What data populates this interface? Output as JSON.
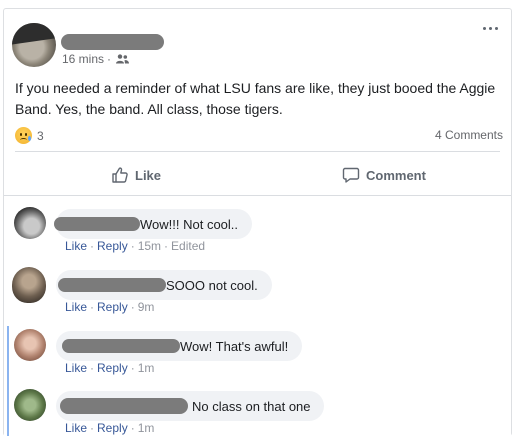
{
  "post": {
    "time": "16 mins",
    "separator": "·",
    "audience_icon": "group-icon",
    "text": "If you needed a reminder of what LSU fans are like, they just booed the Aggie Band. Yes, the band. All class, those tigers.",
    "reaction_icon": "sad-emoji-icon",
    "reaction_count": "3",
    "comment_count": "4 Comments",
    "like_label": "Like",
    "comment_label": "Comment"
  },
  "comments": [
    {
      "text": "Wow!!! Not cool..",
      "like": "Like",
      "reply": "Reply",
      "time": "15m",
      "edited": "Edited",
      "dot": "·"
    },
    {
      "text": "SOOO not cool.",
      "like": "Like",
      "reply": "Reply",
      "time": "9m",
      "dot": "·"
    },
    {
      "text": "Wow! That's awful!",
      "like": "Like",
      "reply": "Reply",
      "time": "1m",
      "dot": "·"
    },
    {
      "text": "No class on that one",
      "like": "Like",
      "reply": "Reply",
      "time": "1m",
      "dot": "·"
    }
  ],
  "colors": {
    "link": "#385898",
    "muted": "#65676b",
    "bubble": "#f0f2f5",
    "thread": "#8bb4f0"
  }
}
